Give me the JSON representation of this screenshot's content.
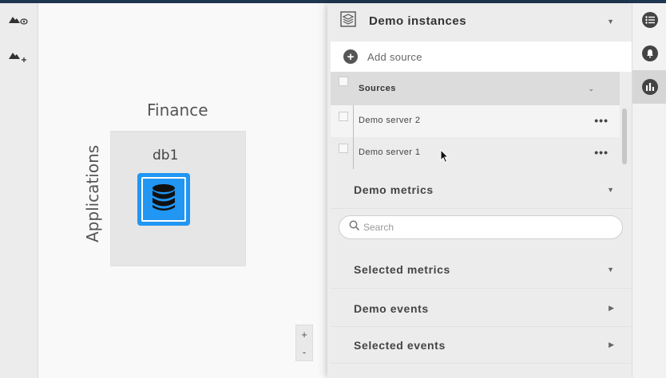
{
  "left_toolbar": {
    "buttons": [
      {
        "name": "toggle-visibility",
        "icon": "mountain-eye-icon"
      },
      {
        "name": "add-layer",
        "icon": "mountain-plus-icon"
      }
    ]
  },
  "canvas": {
    "group_title": "Finance",
    "group_vertical_label": "Applications",
    "node": {
      "label": "db1",
      "icon": "database-icon",
      "color": "#2196f3"
    },
    "zoom_in": "+",
    "zoom_out": "-"
  },
  "panel": {
    "header_title": "Demo instances",
    "add_source_label": "Add source",
    "sources_header": "Sources",
    "sources": [
      {
        "label": "Demo server 2",
        "menu": "•••"
      },
      {
        "label": "Demo server 1",
        "menu": "•••"
      }
    ],
    "demo_metrics_label": "Demo metrics",
    "search_placeholder": "Search",
    "selected_metrics_label": "Selected metrics",
    "demo_events_label": "Demo events",
    "selected_events_label": "Selected events"
  },
  "right_bar": {
    "buttons": [
      {
        "name": "list",
        "icon": "list-icon"
      },
      {
        "name": "notifications",
        "icon": "bell-icon"
      },
      {
        "name": "metrics",
        "icon": "bar-chart-icon",
        "active": true
      }
    ]
  },
  "colors": {
    "accent": "#2196f3",
    "topbar": "#1f3650"
  }
}
